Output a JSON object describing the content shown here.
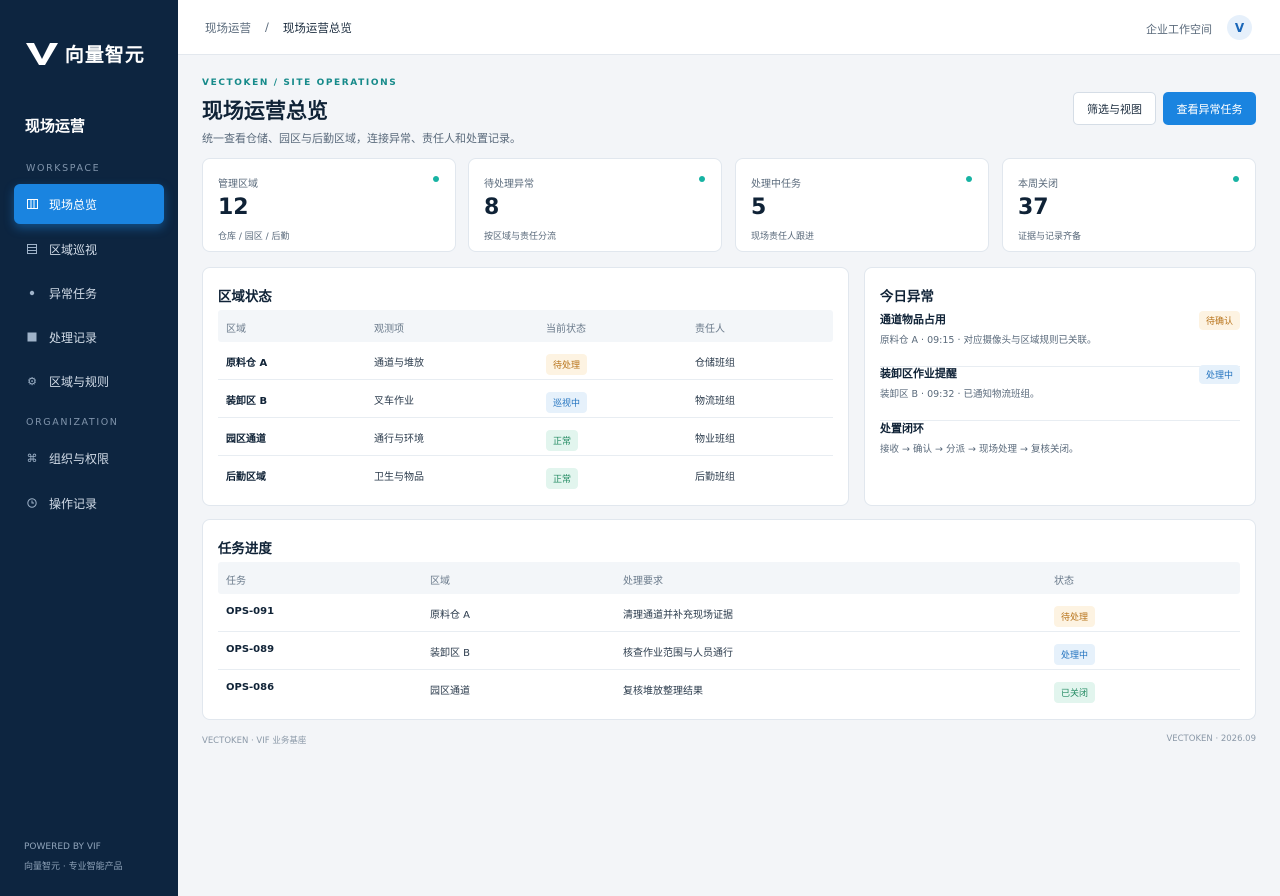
{
  "app": {
    "brand": "向量智元",
    "section": "现场运营"
  },
  "sidebar": {
    "groups": [
      {
        "label": "WORKSPACE"
      },
      {
        "label": "ORGANIZATION"
      }
    ],
    "items": [
      {
        "label": "现场总览",
        "icon": "columns-icon",
        "active": true
      },
      {
        "label": "区域巡视",
        "icon": "list-icon"
      },
      {
        "label": "异常任务",
        "icon": "dot-icon"
      },
      {
        "label": "处理记录",
        "icon": "square-icon"
      },
      {
        "label": "区域与规则",
        "icon": "gear-icon"
      },
      {
        "label": "组织与权限",
        "icon": "command-icon"
      },
      {
        "label": "操作记录",
        "icon": "clock-icon"
      }
    ],
    "footer": {
      "powered": "POWERED BY VIF",
      "tagline": "向量智元 · 专业智能产品"
    }
  },
  "topbar": {
    "breadcrumb": [
      "现场运营",
      "/",
      "现场运营总览"
    ],
    "workspace": "企业工作空间",
    "avatar": "V"
  },
  "header": {
    "eyebrow": "VECTOKEN / SITE OPERATIONS",
    "title": "现场运营总览",
    "description": "统一查看仓储、园区与后勤区域，连接异常、责任人和处置记录。",
    "filter_button": "筛选与视图",
    "primary_button": "查看异常任务"
  },
  "stats": [
    {
      "label": "管理区域",
      "value": "12",
      "sub": "仓库 / 园区 / 后勤"
    },
    {
      "label": "待处理异常",
      "value": "8",
      "sub": "按区域与责任分流"
    },
    {
      "label": "处理中任务",
      "value": "5",
      "sub": "现场责任人跟进"
    },
    {
      "label": "本周关闭",
      "value": "37",
      "sub": "证据与记录齐备"
    }
  ],
  "zone_status": {
    "title": "区域状态",
    "columns": [
      "区域",
      "观测项",
      "当前状态",
      "责任人"
    ],
    "rows": [
      {
        "zone": "原料仓 A",
        "item": "通道与堆放",
        "status": "待处理",
        "owner": "仓储班组"
      },
      {
        "zone": "装卸区 B",
        "item": "叉车作业",
        "status": "巡视中",
        "owner": "物流班组"
      },
      {
        "zone": "园区通道",
        "item": "通行与环境",
        "status": "正常",
        "owner": "物业班组"
      },
      {
        "zone": "后勤区域",
        "item": "卫生与物品",
        "status": "正常",
        "owner": "后勤班组"
      }
    ]
  },
  "anomalies": {
    "title": "今日异常",
    "items": [
      {
        "title": "通道物品占用",
        "desc": "原料仓 A · 09:15 · 对应摄像头与区域规则已关联。",
        "badge": "待确认"
      },
      {
        "title": "装卸区作业提醒",
        "desc": "装卸区 B · 09:32 · 已通知物流班组。",
        "badge": "处理中"
      },
      {
        "title": "处置闭环",
        "desc": "接收 → 确认 → 分派 → 现场处理 → 复核关闭。",
        "badge": ""
      }
    ]
  },
  "tasks": {
    "title": "任务进度",
    "columns": [
      "任务",
      "区域",
      "处理要求",
      "状态"
    ],
    "rows": [
      {
        "id": "OPS-091",
        "zone": "原料仓 A",
        "req": "清理通道并补充现场证据",
        "status": "待处理"
      },
      {
        "id": "OPS-089",
        "zone": "装卸区 B",
        "req": "核查作业范围与人员通行",
        "status": "处理中"
      },
      {
        "id": "OPS-086",
        "zone": "园区通道",
        "req": "复核堆放整理结果",
        "status": "已关闭"
      }
    ]
  },
  "footer": {
    "left": "VECTOKEN  ·  VIF 业务基座",
    "right": "VECTOKEN  ·  2026.09"
  }
}
